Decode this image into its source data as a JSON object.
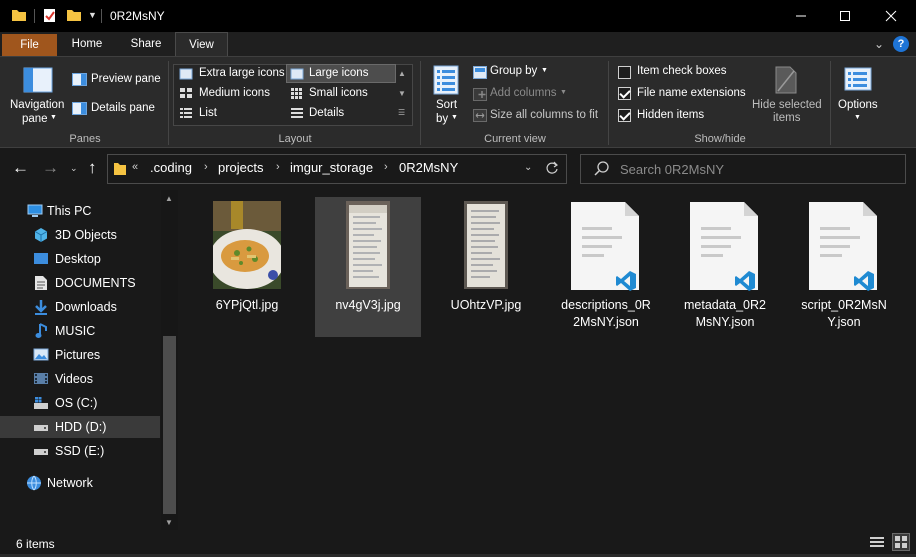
{
  "window": {
    "title": "0R2MsNY",
    "controls": [
      "minimize-icon",
      "maximize-icon",
      "close-icon"
    ]
  },
  "tabs": {
    "file": "File",
    "home": "Home",
    "share": "Share",
    "view": "View",
    "help": "?"
  },
  "ribbon": {
    "panes": {
      "label": "Panes",
      "navigation_pane": [
        "Navigation",
        "pane"
      ],
      "preview_pane": "Preview pane",
      "details_pane": "Details pane"
    },
    "layout": {
      "label": "Layout",
      "options": [
        "Extra large icons",
        "Large icons",
        "Medium icons",
        "Small icons",
        "List",
        "Details"
      ],
      "selected": "Large icons"
    },
    "current_view": {
      "label": "Current view",
      "sort_by": [
        "Sort",
        "by"
      ],
      "group_by": "Group by",
      "add_columns": "Add columns",
      "size_columns": "Size all columns to fit"
    },
    "show_hide": {
      "label": "Show/hide",
      "item_check_boxes": {
        "label": "Item check boxes",
        "checked": false
      },
      "file_name_extensions": {
        "label": "File name extensions",
        "checked": true
      },
      "hidden_items": {
        "label": "Hidden items",
        "checked": true
      },
      "hide_selected": [
        "Hide selected",
        "items"
      ]
    },
    "options": "Options"
  },
  "address": {
    "overflow": "«",
    "path": [
      ".coding",
      "projects",
      "imgur_storage",
      "0R2MsNY"
    ],
    "search_placeholder": "Search 0R2MsNY"
  },
  "sidebar": {
    "items": [
      {
        "label": "This PC",
        "icon": "computer-icon",
        "indent": 0
      },
      {
        "label": "3D Objects",
        "icon": "cube-icon",
        "indent": 1
      },
      {
        "label": "Desktop",
        "icon": "desktop-icon",
        "indent": 1
      },
      {
        "label": "DOCUMENTS",
        "icon": "document-icon",
        "indent": 1
      },
      {
        "label": "Downloads",
        "icon": "download-icon",
        "indent": 1
      },
      {
        "label": "MUSIC",
        "icon": "music-icon",
        "indent": 1
      },
      {
        "label": "Pictures",
        "icon": "pictures-icon",
        "indent": 1
      },
      {
        "label": "Videos",
        "icon": "video-icon",
        "indent": 1
      },
      {
        "label": "OS (C:)",
        "icon": "os-drive-icon",
        "indent": 1
      },
      {
        "label": "HDD (D:)",
        "icon": "drive-icon",
        "indent": 1,
        "selected": true
      },
      {
        "label": "SSD (E:)",
        "icon": "drive-icon",
        "indent": 1
      },
      {
        "label": "Network",
        "icon": "network-icon",
        "indent": 0
      }
    ]
  },
  "files": [
    {
      "name": [
        "6YPjQtl.jpg"
      ],
      "type": "photo-food"
    },
    {
      "name": [
        "nv4gV3j.jpg"
      ],
      "type": "photo-paper",
      "selected": true
    },
    {
      "name": [
        "UOhtzVP.jpg"
      ],
      "type": "photo-paper"
    },
    {
      "name": [
        "descriptions_0R",
        "2MsNY.json"
      ],
      "type": "json"
    },
    {
      "name": [
        "metadata_0R2",
        "MsNY.json"
      ],
      "type": "json"
    },
    {
      "name": [
        "script_0R2MsN",
        "Y.json"
      ],
      "type": "json"
    }
  ],
  "status": {
    "count": "6 items"
  },
  "colors": {
    "file_tab": "#a0561d",
    "accent_blue": "#1e74d6",
    "folder_yellow": "#f5c342",
    "vscode_blue": "#1f8ad2"
  }
}
